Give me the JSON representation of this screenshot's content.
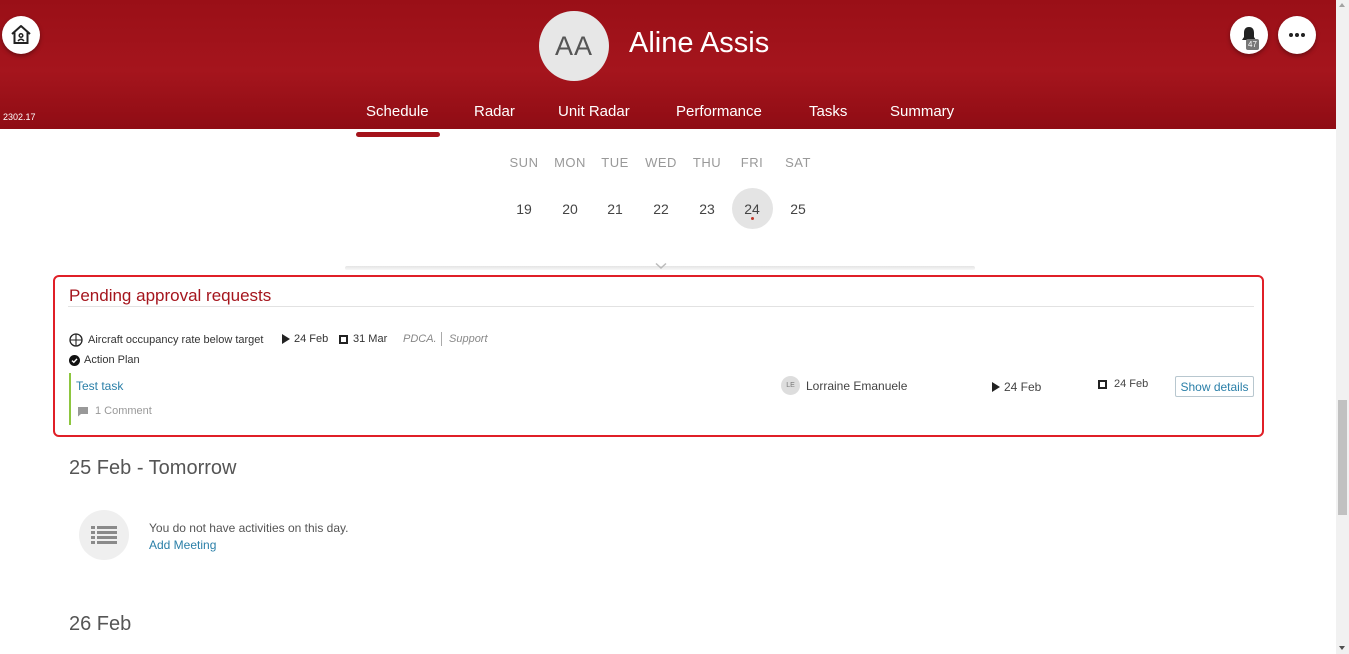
{
  "header": {
    "version": "2302.17",
    "user_initials": "AA",
    "user_name": "Aline Assis",
    "notification_count": "47",
    "brand_color": "#a5151d"
  },
  "nav": {
    "tabs": [
      {
        "label": "Schedule",
        "active": true
      },
      {
        "label": "Radar"
      },
      {
        "label": "Unit Radar"
      },
      {
        "label": "Performance"
      },
      {
        "label": "Tasks"
      },
      {
        "label": "Summary"
      }
    ]
  },
  "week": {
    "days": [
      {
        "name": "SUN",
        "num": "19"
      },
      {
        "name": "MON",
        "num": "20"
      },
      {
        "name": "TUE",
        "num": "21"
      },
      {
        "name": "WED",
        "num": "22"
      },
      {
        "name": "THU",
        "num": "23"
      },
      {
        "name": "FRI",
        "num": "24",
        "selected": true
      },
      {
        "name": "SAT",
        "num": "25"
      }
    ]
  },
  "pending": {
    "title": "Pending approval requests",
    "indicator": "Aircraft occupancy rate below target",
    "start_date": "24 Feb",
    "end_date": "31 Mar",
    "method": "PDCA.",
    "area": "Support",
    "type": "Action Plan",
    "task": {
      "name": "Test task",
      "comments": "1 Comment",
      "assignee_initials": "LE",
      "assignee_name": "Lorraine Emanuele",
      "start": "24 Feb",
      "end": "24 Feb",
      "details_label": "Show details"
    }
  },
  "days": [
    {
      "title": "25 Feb - Tomorrow",
      "empty_message": "You do not have activities on this day.",
      "add_label": "Add Meeting"
    },
    {
      "title": "26 Feb"
    }
  ]
}
